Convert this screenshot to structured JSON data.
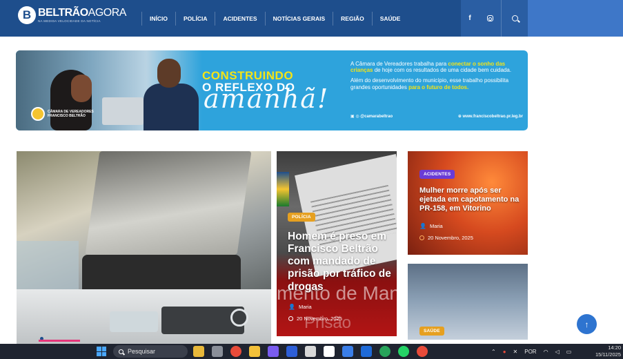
{
  "header": {
    "logo_title_bold": "BELTRÃO",
    "logo_title_light": "AGORA",
    "logo_tagline": "NA MEDIDA VELOCIDADE DA NOTÍCIA",
    "nav": [
      "INÍCIO",
      "POLÍCIA",
      "ACIDENTES",
      "NOTÍCIAS GERAIS",
      "REGIÃO",
      "SAÚDE"
    ],
    "social": [
      "facebook-icon",
      "instagram-icon"
    ],
    "search_icon": "search-icon",
    "colors": {
      "primary": "#1e4e8c",
      "accent": "#3e77c8"
    }
  },
  "banner": {
    "headline_1": "CONSTRUINDO",
    "headline_2": "O REFLEXO DO",
    "headline_3": "amanhã!",
    "body_1_pre": "A Câmara de Vereadores  trabalha para ",
    "body_1_hl": "conectar o sonho das crianças",
    "body_1_post": " de hoje com os resultados de uma cidade bem cuidada.",
    "body_2_pre": "Além do desenvolvimento do município, esse trabalho possibilita grandes oportunidades ",
    "body_2_hl": "para o futuro de todos.",
    "handle": "@camarabeltrao",
    "site": "www.franciscobeltrao.pr.leg.br",
    "seal_line1": "CÂMARA DE VEREADORES",
    "seal_line2": "FRANCISCO BELTRÃO",
    "colors": {
      "background": "#2ea3dc",
      "highlight": "#f5e415"
    }
  },
  "cards": {
    "middle": {
      "badge": "POLÍCIA",
      "title": "Homem é preso em Francisco Beltrão com mandado de prisão por tráfico de drogas",
      "author": "Maria",
      "date": "20 Novembro, 2025",
      "bg_text_1": "mento de Mand",
      "bg_text_2": "Prisão"
    },
    "top_right": {
      "badge": "ACIDENTES",
      "title": "Mulher morre após ser ejetada em capotamento na PR-158, em Vitorino",
      "author": "Maria",
      "date": "20 Novembro, 2025"
    },
    "bottom_right": {
      "badge": "SAÚDE"
    },
    "badge_colors": {
      "policia": "#e6a020",
      "acidentes": "#6a3bd6",
      "saude": "#e6a020"
    }
  },
  "taskbar": {
    "search_placeholder": "Pesquisar",
    "language": "POR",
    "time": "14:20",
    "date": "15/11/2025"
  }
}
